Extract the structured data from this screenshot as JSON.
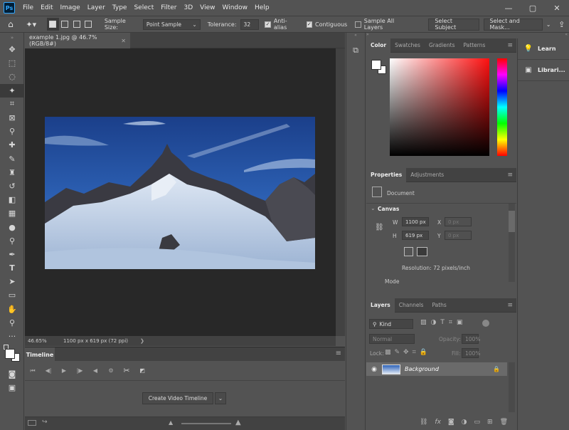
{
  "app": {
    "logo_text": "Ps"
  },
  "menu": [
    "File",
    "Edit",
    "Image",
    "Layer",
    "Type",
    "Select",
    "Filter",
    "3D",
    "View",
    "Window",
    "Help"
  ],
  "window_controls": {
    "minimize": "—",
    "maximize": "▢",
    "close": "✕"
  },
  "options": {
    "sample_size_label": "Sample Size:",
    "sample_size_value": "Point Sample",
    "tolerance_label": "Tolerance:",
    "tolerance_value": "32",
    "anti_alias": "Anti-alias",
    "contiguous": "Contiguous",
    "sample_all_layers": "Sample All Layers",
    "select_subject": "Select Subject",
    "select_and_mask": "Select and Mask..."
  },
  "document": {
    "tab_title": "example 1.jpg @ 46.7% (RGB/8#)",
    "tab_close": "✕",
    "zoom": "46.65%",
    "doc_info": "1100 px x 619 px (72 ppi)",
    "status_arrow": "❯"
  },
  "timeline": {
    "tab_label": "Timeline",
    "create_video": "Create Video Timeline"
  },
  "color_panel": {
    "tabs": [
      "Color",
      "Swatches",
      "Gradients",
      "Patterns"
    ],
    "hue_color": "#ff1010"
  },
  "properties_panel": {
    "tabs": [
      "Properties",
      "Adjustments"
    ],
    "doc_label": "Document",
    "section": "Canvas",
    "w_label": "W",
    "w_value": "1100 px",
    "h_label": "H",
    "h_value": "619 px",
    "x_label": "X",
    "x_value": "0 px",
    "y_label": "Y",
    "y_value": "0 px",
    "resolution": "Resolution: 72 pixels/inch",
    "mode": "Mode"
  },
  "layers_panel": {
    "tabs": [
      "Layers",
      "Channels",
      "Paths"
    ],
    "filter_kind": "Kind",
    "blend_mode": "Normal",
    "opacity_label": "Opacity:",
    "opacity_value": "100%",
    "lock_label": "Lock:",
    "fill_label": "Fill:",
    "fill_value": "100%",
    "layer_name": "Background"
  },
  "learn_panel": {
    "items": [
      "Learn",
      "Librari..."
    ]
  }
}
